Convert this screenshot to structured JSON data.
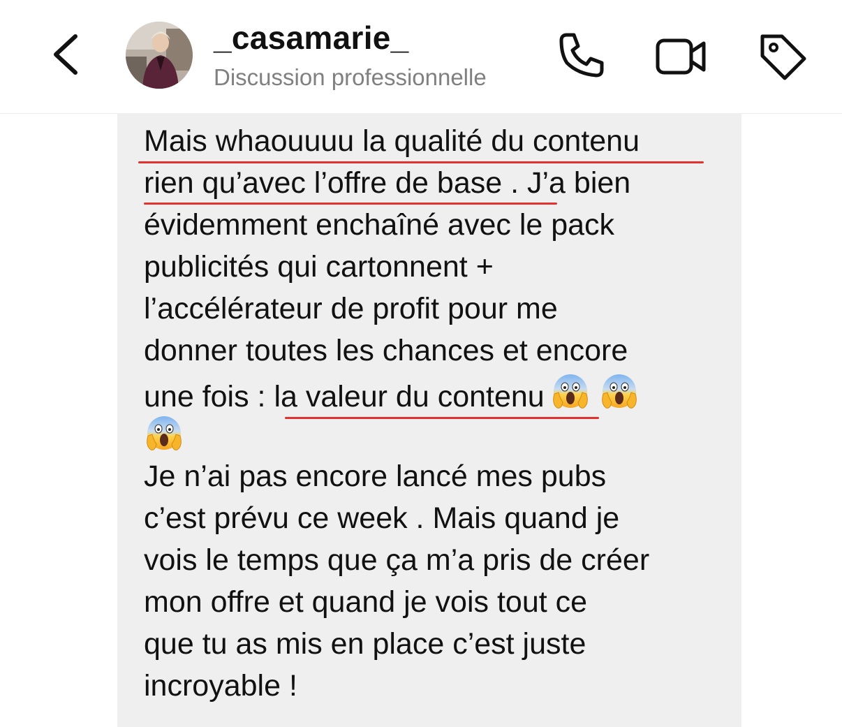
{
  "header": {
    "back_icon": "chevron-left-icon",
    "username": "_casamarie_",
    "subtitle": "Discussion professionnelle",
    "actions": [
      "phone-icon",
      "video-camera-icon",
      "tag-icon"
    ]
  },
  "message": {
    "lines": [
      "Mais whaouuuu la qualité du contenu",
      "rien qu’avec l’offre de base . J’a bien",
      "évidemment enchaîné avec le pack",
      "publicités qui cartonnent +",
      "l’accélérateur de profit pour me",
      "donner toutes les chances et encore",
      "une fois : la valeur du contenu",
      "",
      "Je n’ai pas encore lancé mes pubs",
      "c’est prévu ce week . Mais quand je",
      "vois le temps que ça m’a pris de créer",
      "mon offre et quand je vois tout ce",
      "que tu as mis en place c’est juste",
      "incroyable !"
    ],
    "emoji": "screaming-face-emoji",
    "underline_color": "#e0322f",
    "bubble_color": "#efefef"
  }
}
